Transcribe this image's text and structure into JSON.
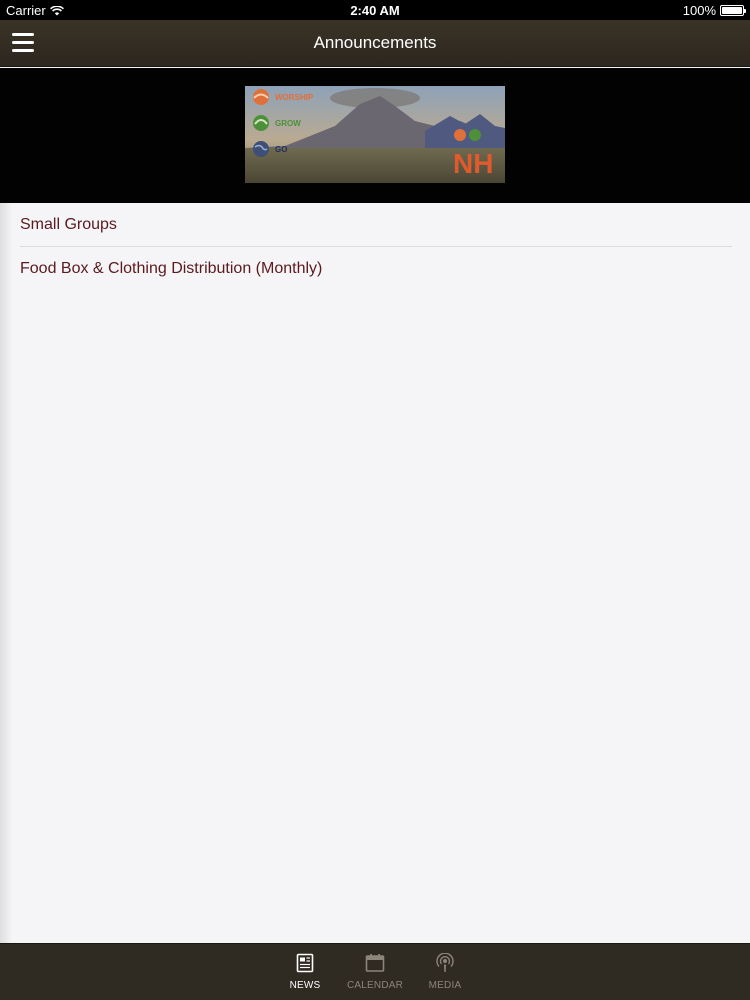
{
  "status_bar": {
    "carrier": "Carrier",
    "time": "2:40 AM",
    "battery": "100%"
  },
  "nav": {
    "title": "Announcements",
    "menu_icon": "hamburger-menu-icon"
  },
  "banner": {
    "labels": [
      "WORSHIP",
      "GROW",
      "GO"
    ],
    "logo": "NH",
    "colors": {
      "worship": "#e0703a",
      "grow": "#4e8f3a",
      "go": "#3d4f76",
      "logo": "#e05a2c"
    }
  },
  "announcements": [
    {
      "label": "Small Groups"
    },
    {
      "label": "Food Box & Clothing Distribution (Monthly)"
    }
  ],
  "tabs": [
    {
      "label": "NEWS",
      "icon": "news-icon",
      "active": true
    },
    {
      "label": "CALENDAR",
      "icon": "calendar-icon",
      "active": false
    },
    {
      "label": "MEDIA",
      "icon": "media-podcast-icon",
      "active": false
    }
  ],
  "colors": {
    "list_text": "#5a1a1f",
    "bar_bg": "#2f2a22",
    "page_bg": "#f5f5f7"
  }
}
